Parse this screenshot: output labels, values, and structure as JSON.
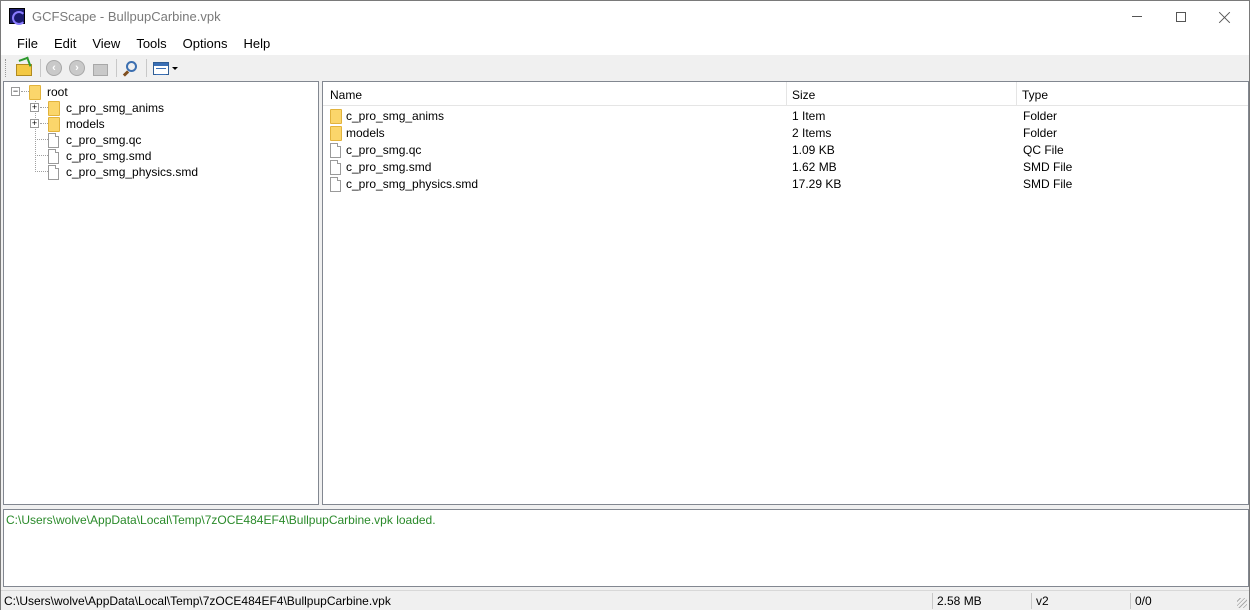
{
  "window": {
    "title": "GCFScape - BullpupCarbine.vpk"
  },
  "menu": [
    "File",
    "Edit",
    "View",
    "Tools",
    "Options",
    "Help"
  ],
  "toolbar": {
    "buttons": [
      "open-icon",
      "back-icon",
      "forward-icon",
      "up-folder-icon",
      "find-icon",
      "view-mode-icon"
    ]
  },
  "tree": {
    "root_label": "root",
    "children": [
      {
        "label": "c_pro_smg_anims",
        "kind": "folder"
      },
      {
        "label": "models",
        "kind": "folder"
      },
      {
        "label": "c_pro_smg.qc",
        "kind": "file"
      },
      {
        "label": "c_pro_smg.smd",
        "kind": "file"
      },
      {
        "label": "c_pro_smg_physics.smd",
        "kind": "file"
      }
    ]
  },
  "list": {
    "columns": [
      "Name",
      "Size",
      "Type"
    ],
    "rows": [
      {
        "name": "c_pro_smg_anims",
        "size": "1 Item",
        "type": "Folder",
        "kind": "folder"
      },
      {
        "name": "models",
        "size": "2 Items",
        "type": "Folder",
        "kind": "folder"
      },
      {
        "name": "c_pro_smg.qc",
        "size": "1.09 KB",
        "type": "QC File",
        "kind": "file"
      },
      {
        "name": "c_pro_smg.smd",
        "size": "1.62 MB",
        "type": "SMD File",
        "kind": "file"
      },
      {
        "name": "c_pro_smg_physics.smd",
        "size": "17.29 KB",
        "type": "SMD File",
        "kind": "file"
      }
    ]
  },
  "log": {
    "line": "C:\\Users\\wolve\\AppData\\Local\\Temp\\7zOCE484EF4\\BullpupCarbine.vpk loaded.",
    "color": "#2a8a2a"
  },
  "status": {
    "path": "C:\\Users\\wolve\\AppData\\Local\\Temp\\7zOCE484EF4\\BullpupCarbine.vpk",
    "size": "2.58 MB",
    "version": "v2",
    "fragmentation": "0/0"
  }
}
